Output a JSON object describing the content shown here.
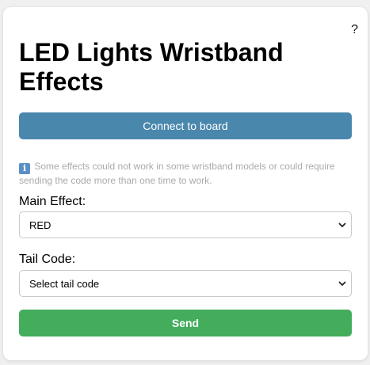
{
  "header": {
    "help_label": "?",
    "title": "LED Lights Wristband Effects"
  },
  "connect": {
    "label": "Connect to board",
    "color": "#4a87ad"
  },
  "note": {
    "icon": "info-icon",
    "icon_glyph": "i",
    "text": "Some effects could not work in some wristband models or could require sending the code more than one time to work."
  },
  "main_effect": {
    "label": "Main Effect:",
    "selected": "RED"
  },
  "tail_code": {
    "label": "Tail Code:",
    "selected": "Select tail code"
  },
  "send": {
    "label": "Send",
    "color": "#43ad5c"
  }
}
